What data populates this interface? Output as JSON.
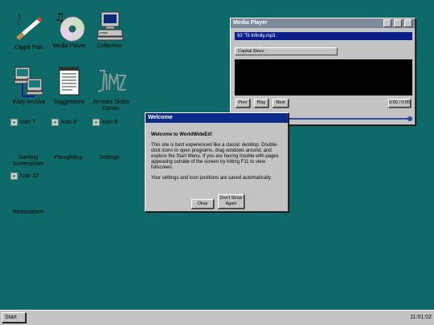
{
  "desktop": {
    "icons": [
      {
        "label": "Ciggie Pals",
        "icon": "cigarette-icon"
      },
      {
        "label": "Media Player",
        "icon": "cd-music-icon"
      },
      {
        "label": "Collection",
        "icon": "computer-icon"
      },
      {
        "label": "Eddy Archive",
        "icon": "network-computers-icon"
      },
      {
        "label": "Suggestions",
        "icon": "notepad-icon"
      },
      {
        "label": "Jimmies Skitzo Corner",
        "icon": "jimz-graffiti-icon"
      },
      {
        "label": "Icon 7",
        "icon": "broken-image-icon"
      },
      {
        "label": "Icon 8",
        "icon": "broken-image-icon"
      },
      {
        "label": "Icon 9",
        "icon": "broken-image-icon"
      },
      {
        "label": "Gaming Screenshots"
      },
      {
        "label": "Paragliding"
      },
      {
        "label": "Settings"
      },
      {
        "label": "Icon 10",
        "icon": "broken-image-icon"
      },
      {
        "label": "Restorations"
      }
    ]
  },
  "media_player": {
    "title": "Media Player",
    "track": "93 'Til Infinity.mp3",
    "playlist": "Capital Steez",
    "buttons": {
      "prev": "Prev",
      "play": "Play",
      "next": "Next"
    },
    "time": "0:00 / 0:00",
    "volume": 1.0
  },
  "welcome": {
    "title": "Welcome",
    "heading": "Welcome to WorldWideEd!",
    "paragraph1": "This site is best experienced like a classic desktop. Double-click icons to open programs, drag windows around, and explore the Start Menu. If you are having trouble with pages appearing outside of the screen try hitting F11 to view fullscreen.",
    "paragraph2": "Your settings and icon positions are saved automatically.",
    "okay_label": "Okay",
    "dont_show_label": "Don't Show Again"
  },
  "taskbar": {
    "start_label": "Start",
    "clock": "11:01:02"
  },
  "colors": {
    "desktop": "#0e6a68",
    "title_active": "#0c2a8a",
    "title_inactive": "#7d8a9c"
  }
}
